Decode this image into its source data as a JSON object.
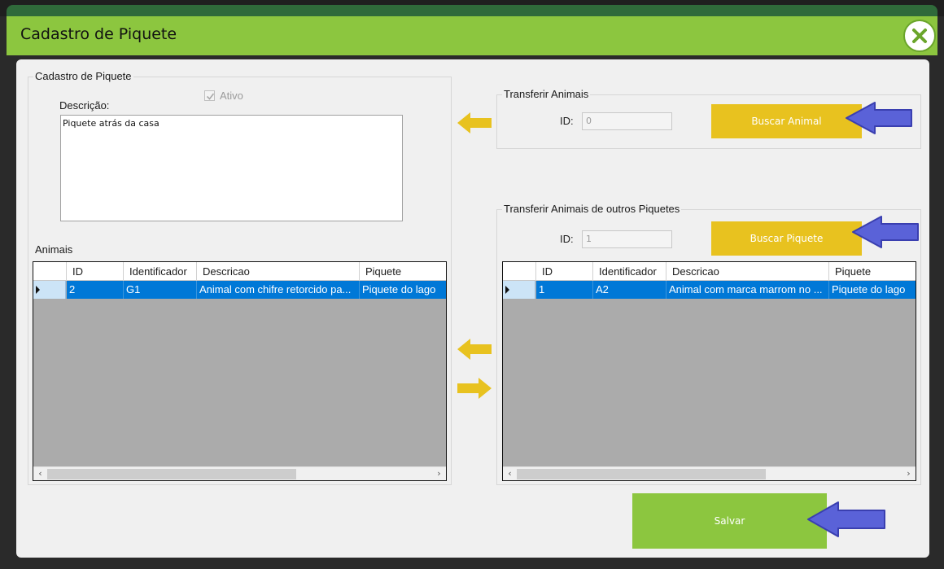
{
  "window": {
    "title": "Cadastro de Piquete",
    "close_icon": "close-icon"
  },
  "cadastro": {
    "legend": "Cadastro de Piquete",
    "ativo_label": "Ativo",
    "ativo_checked": true,
    "descricao_label": "Descrição:",
    "descricao_value": "Piquete atrás da casa",
    "animais_label": "Animais",
    "grid": {
      "columns": [
        "ID",
        "Identificador",
        "Descricao",
        "Piquete"
      ],
      "rows": [
        {
          "id": "2",
          "identificador": "G1",
          "descricao": "Animal com chifre retorcido pa...",
          "piquete": "Piquete do lago"
        }
      ]
    }
  },
  "transferir": {
    "legend": "Transferir Animais",
    "id_label": "ID:",
    "id_value": "0",
    "button_label": "Buscar Animal"
  },
  "outros": {
    "legend": "Transferir Animais de outros Piquetes",
    "id_label": "ID:",
    "id_value": "1",
    "button_label": "Buscar Piquete",
    "grid": {
      "columns": [
        "ID",
        "Identificador",
        "Descricao",
        "Piquete"
      ],
      "rows": [
        {
          "id": "1",
          "identificador": "A2",
          "descricao": "Animal com marca marrom no ...",
          "piquete": "Piquete do lago"
        }
      ]
    }
  },
  "footer": {
    "save_label": "Salvar"
  },
  "colors": {
    "accent_green": "#8cc63f",
    "button_yellow": "#e8c21f",
    "selection_blue": "#0078d7",
    "annotation_arrow": "#5a62d8"
  }
}
